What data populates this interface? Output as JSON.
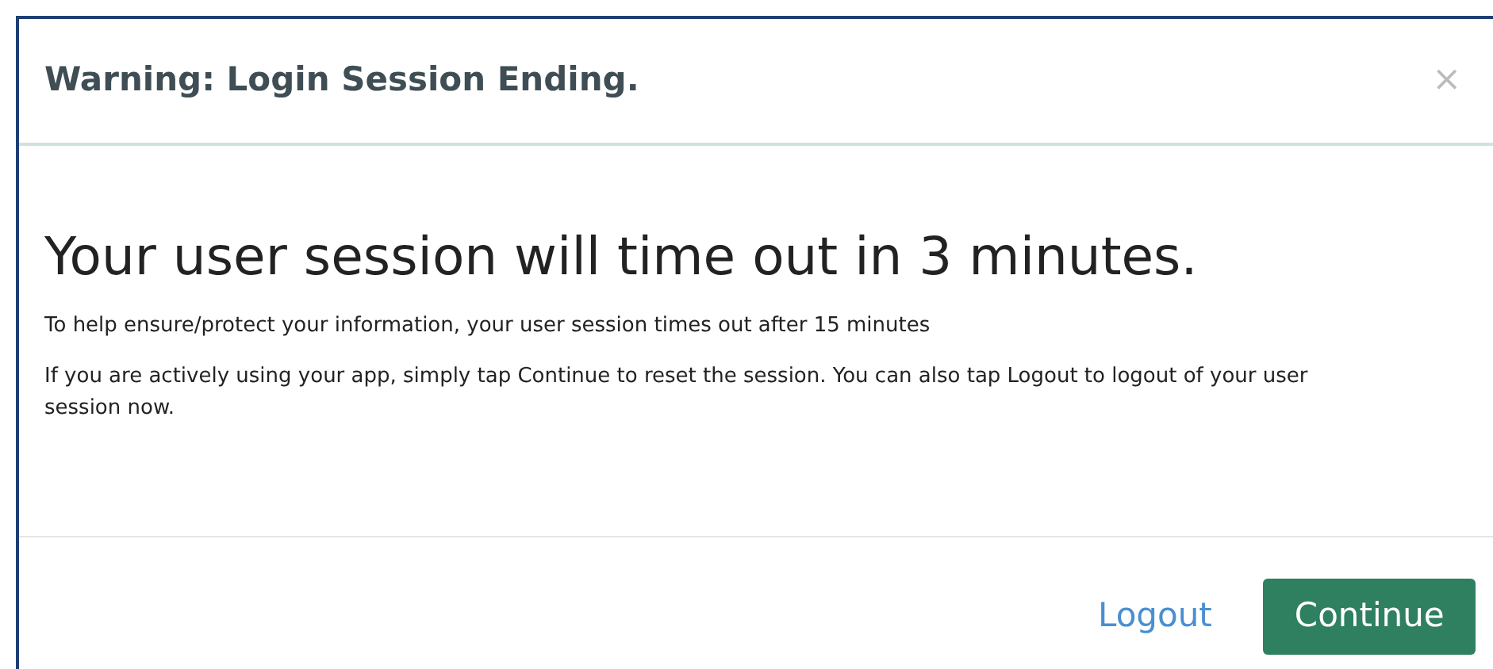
{
  "dialog": {
    "title": "Warning: Login Session Ending.",
    "close": "×",
    "heading": "Your user session will time out in 3 minutes.",
    "paragraphs": [
      "To help ensure/protect your information, your user session times out after 15 minutes",
      "If you are actively using your app, simply tap Continue to reset the session. You can also tap Logout to logout of your user session now."
    ],
    "buttons": [
      {
        "label": "Logout",
        "kind": "link"
      },
      {
        "label": "Continue",
        "kind": "primary"
      }
    ]
  }
}
